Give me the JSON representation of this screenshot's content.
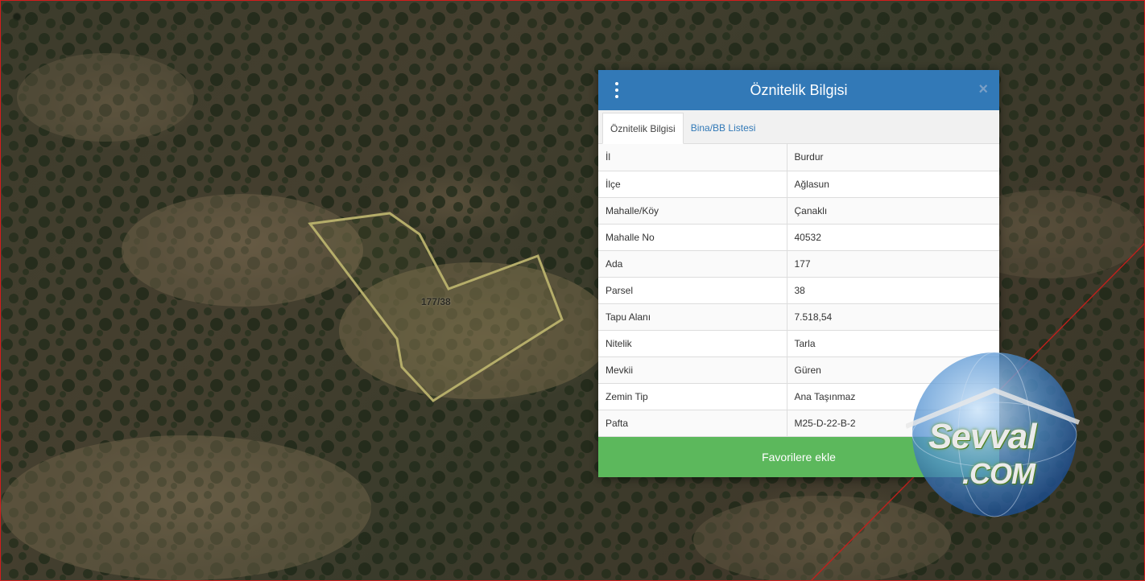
{
  "map": {
    "parcel_label": "177/38"
  },
  "panel": {
    "title": "Öznitelik Bilgisi",
    "tabs": [
      {
        "label": "Öznitelik Bilgisi",
        "active": true
      },
      {
        "label": "Bina/BB Listesi",
        "active": false
      }
    ],
    "rows": [
      {
        "key": "İl",
        "value": "Burdur"
      },
      {
        "key": "İlçe",
        "value": "Ağlasun"
      },
      {
        "key": "Mahalle/Köy",
        "value": "Çanaklı"
      },
      {
        "key": "Mahalle No",
        "value": "40532"
      },
      {
        "key": "Ada",
        "value": "177"
      },
      {
        "key": "Parsel",
        "value": "38"
      },
      {
        "key": "Tapu Alanı",
        "value": "7.518,54"
      },
      {
        "key": "Nitelik",
        "value": "Tarla"
      },
      {
        "key": "Mevkii",
        "value": "Güren"
      },
      {
        "key": "Zemin Tip",
        "value": "Ana Taşınmaz"
      },
      {
        "key": "Pafta",
        "value": "M25-D-22-B-2"
      }
    ],
    "favorite_button": "Favorilere ekle"
  },
  "watermark": {
    "line1": "Sevval",
    "line2": ".COM"
  },
  "colors": {
    "header": "#3279b7",
    "button": "#5cb85c",
    "parcel_outline": "#b5ad6a",
    "boundary_line": "#c0201c"
  }
}
